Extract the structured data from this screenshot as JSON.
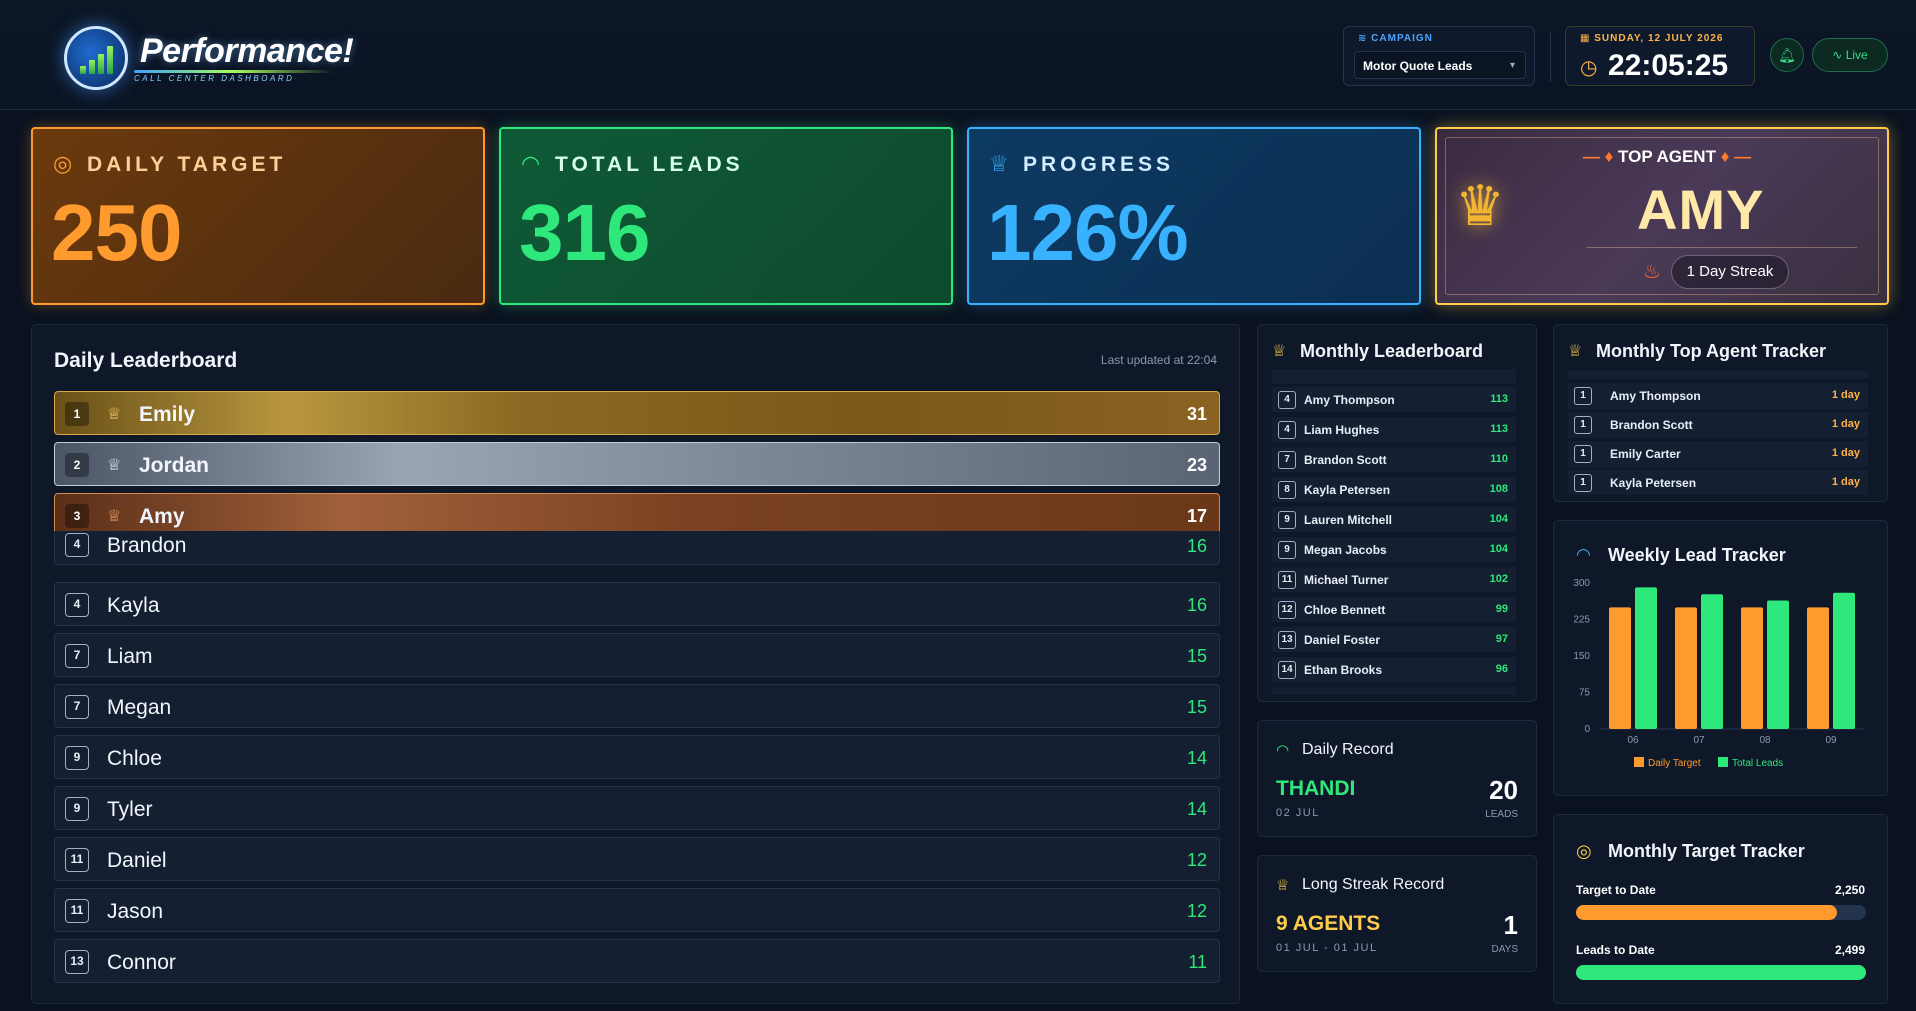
{
  "header": {
    "logo_title": "Performance!",
    "logo_subtitle": "CALL CENTER DASHBOARD",
    "campaign_label": "CAMPAIGN",
    "campaign_value": "Motor Quote Leads",
    "date": "SUNDAY, 12 JULY 2026",
    "time": "22:05:25",
    "live_label": "Live"
  },
  "stats": {
    "daily_target_label": "DAILY TARGET",
    "daily_target_value": "250",
    "total_leads_label": "TOTAL LEADS",
    "total_leads_value": "316",
    "progress_label": "PROGRESS",
    "progress_value": "126%",
    "top_agent_label": "TOP AGENT",
    "top_agent_name": "AMY",
    "top_agent_streak": "1 Day Streak"
  },
  "daily_leaderboard": {
    "title": "Daily Leaderboard",
    "updated": "Last updated at 22:04",
    "rows": [
      {
        "rank": "1",
        "name": "Emily",
        "score": "31"
      },
      {
        "rank": "2",
        "name": "Jordan",
        "score": "23"
      },
      {
        "rank": "3",
        "name": "Amy",
        "score": "17"
      },
      {
        "rank": "4",
        "name": "Brandon",
        "score": "16"
      },
      {
        "rank": "4",
        "name": "Kayla",
        "score": "16"
      },
      {
        "rank": "7",
        "name": "Liam",
        "score": "15"
      },
      {
        "rank": "7",
        "name": "Megan",
        "score": "15"
      },
      {
        "rank": "9",
        "name": "Chloe",
        "score": "14"
      },
      {
        "rank": "9",
        "name": "Tyler",
        "score": "14"
      },
      {
        "rank": "11",
        "name": "Daniel",
        "score": "12"
      },
      {
        "rank": "11",
        "name": "Jason",
        "score": "12"
      },
      {
        "rank": "13",
        "name": "Connor",
        "score": "11"
      }
    ]
  },
  "monthly_leaderboard": {
    "title": "Monthly Leaderboard",
    "rows": [
      {
        "rank": "4",
        "name": "Amy Thompson",
        "score": "113"
      },
      {
        "rank": "4",
        "name": "Liam Hughes",
        "score": "113"
      },
      {
        "rank": "7",
        "name": "Brandon Scott",
        "score": "110"
      },
      {
        "rank": "8",
        "name": "Kayla Petersen",
        "score": "108"
      },
      {
        "rank": "9",
        "name": "Lauren Mitchell",
        "score": "104"
      },
      {
        "rank": "9",
        "name": "Megan Jacobs",
        "score": "104"
      },
      {
        "rank": "11",
        "name": "Michael Turner",
        "score": "102"
      },
      {
        "rank": "12",
        "name": "Chloe Bennett",
        "score": "99"
      },
      {
        "rank": "13",
        "name": "Daniel Foster",
        "score": "97"
      },
      {
        "rank": "14",
        "name": "Ethan Brooks",
        "score": "96"
      }
    ]
  },
  "top_agent_tracker": {
    "title": "Monthly Top Agent Tracker",
    "rows": [
      {
        "rank": "1",
        "name": "Amy Thompson",
        "days": "1 day"
      },
      {
        "rank": "1",
        "name": "Brandon Scott",
        "days": "1 day"
      },
      {
        "rank": "1",
        "name": "Emily Carter",
        "days": "1 day"
      },
      {
        "rank": "1",
        "name": "Kayla Petersen",
        "days": "1 day"
      }
    ]
  },
  "daily_record": {
    "title": "Daily Record",
    "name": "THANDI",
    "date": "02 JUL",
    "value": "20",
    "unit": "LEADS"
  },
  "long_streak": {
    "title": "Long Streak Record",
    "name": "9 AGENTS",
    "date": "01 JUL - 01 JUL",
    "value": "1",
    "unit": "DAYS"
  },
  "monthly_target": {
    "title": "Monthly Target Tracker",
    "target_label": "Target to Date",
    "target_value": "2,250",
    "target_fill": 0.9,
    "leads_label": "Leads to Date",
    "leads_value": "2,499",
    "leads_fill": 1.0
  },
  "chart_data": {
    "type": "bar",
    "title": "Weekly Lead Tracker",
    "categories": [
      "06",
      "07",
      "08",
      "09"
    ],
    "series": [
      {
        "name": "Daily Target",
        "color": "#ff9a2e",
        "values": [
          250,
          250,
          250,
          250
        ]
      },
      {
        "name": "Total Leads",
        "color": "#2ee87c",
        "values": [
          291,
          277,
          264,
          280
        ]
      }
    ],
    "yticks": [
      "0",
      "75",
      "150",
      "225",
      "300"
    ],
    "ylim": [
      0,
      300
    ],
    "legend": "bottom",
    "grid": false
  },
  "colors": {
    "accent_orange": "#ff9a2e",
    "accent_green": "#2ee87c",
    "accent_blue": "#38b2ff",
    "accent_gold": "#ffcc4a"
  }
}
